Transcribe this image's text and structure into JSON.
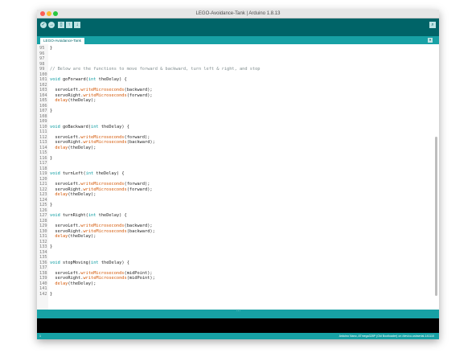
{
  "window": {
    "title": "LEGO-Avoidance-Tank | Arduino 1.8.13"
  },
  "toolbar": {
    "buttons": [
      {
        "icon": "verify-icon",
        "glyph": "✓"
      },
      {
        "icon": "upload-icon",
        "glyph": "→"
      },
      {
        "icon": "new-icon",
        "glyph": "▯"
      },
      {
        "icon": "open-icon",
        "glyph": "↑"
      },
      {
        "icon": "save-icon",
        "glyph": "↓"
      }
    ],
    "serial_monitor_glyph": "⌕"
  },
  "tabs": {
    "active": "LEGO-Avoidance-Tank",
    "menu_glyph": "▾"
  },
  "editor": {
    "lines": [
      {
        "n": "95",
        "t": "}"
      },
      {
        "n": "96",
        "t": ""
      },
      {
        "n": "97",
        "t": ""
      },
      {
        "n": "98",
        "t": ""
      },
      {
        "n": "99",
        "t": "// Below are the functions to move forward & backward, turn left & right, and stop"
      },
      {
        "n": "100",
        "t": ""
      },
      {
        "n": "101",
        "t": "void goForward(int theDelay) {"
      },
      {
        "n": "102",
        "t": ""
      },
      {
        "n": "103",
        "t": "  servoLeft.writeMicroseconds(backward);"
      },
      {
        "n": "104",
        "t": "  servoRight.writeMicroseconds(forward);"
      },
      {
        "n": "105",
        "t": "  delay(theDelay);"
      },
      {
        "n": "106",
        "t": ""
      },
      {
        "n": "107",
        "t": "}"
      },
      {
        "n": "108",
        "t": ""
      },
      {
        "n": "109",
        "t": ""
      },
      {
        "n": "110",
        "t": "void goBackward(int theDelay) {"
      },
      {
        "n": "111",
        "t": ""
      },
      {
        "n": "112",
        "t": "  servoLeft.writeMicroseconds(forward);"
      },
      {
        "n": "113",
        "t": "  servoRight.writeMicroseconds(backward);"
      },
      {
        "n": "114",
        "t": "  delay(theDelay);"
      },
      {
        "n": "115",
        "t": ""
      },
      {
        "n": "116",
        "t": "}"
      },
      {
        "n": "117",
        "t": ""
      },
      {
        "n": "118",
        "t": ""
      },
      {
        "n": "119",
        "t": "void turnLeft(int theDelay) {"
      },
      {
        "n": "120",
        "t": ""
      },
      {
        "n": "121",
        "t": "  servoLeft.writeMicroseconds(forward);"
      },
      {
        "n": "122",
        "t": "  servoRight.writeMicroseconds(forward);"
      },
      {
        "n": "123",
        "t": "  delay(theDelay);"
      },
      {
        "n": "124",
        "t": ""
      },
      {
        "n": "125",
        "t": "}"
      },
      {
        "n": "126",
        "t": ""
      },
      {
        "n": "127",
        "t": "void turnRight(int theDelay) {"
      },
      {
        "n": "128",
        "t": ""
      },
      {
        "n": "129",
        "t": "  servoLeft.writeMicroseconds(backward);"
      },
      {
        "n": "130",
        "t": "  servoRight.writeMicroseconds(backward);"
      },
      {
        "n": "131",
        "t": "  delay(theDelay);"
      },
      {
        "n": "132",
        "t": ""
      },
      {
        "n": "133",
        "t": "}"
      },
      {
        "n": "134",
        "t": ""
      },
      {
        "n": "135",
        "t": ""
      },
      {
        "n": "136",
        "t": "void stopMoving(int theDelay) {"
      },
      {
        "n": "137",
        "t": ""
      },
      {
        "n": "138",
        "t": "  servoLeft.writeMicroseconds(midPoint);"
      },
      {
        "n": "139",
        "t": "  servoRight.writeMicroseconds(midPoint);"
      },
      {
        "n": "140",
        "t": "  delay(theDelay);"
      },
      {
        "n": "141",
        "t": ""
      },
      {
        "n": "142",
        "t": "}"
      }
    ]
  },
  "status": {
    "line": "1",
    "board": "Arduino Nano, ATmega328P (Old Bootloader) on /dev/cu.usbserial-141110"
  },
  "colors": {
    "teal_dark": "#006468",
    "teal": "#17a1a5",
    "keyword": "#00979d",
    "function": "#d35400"
  }
}
